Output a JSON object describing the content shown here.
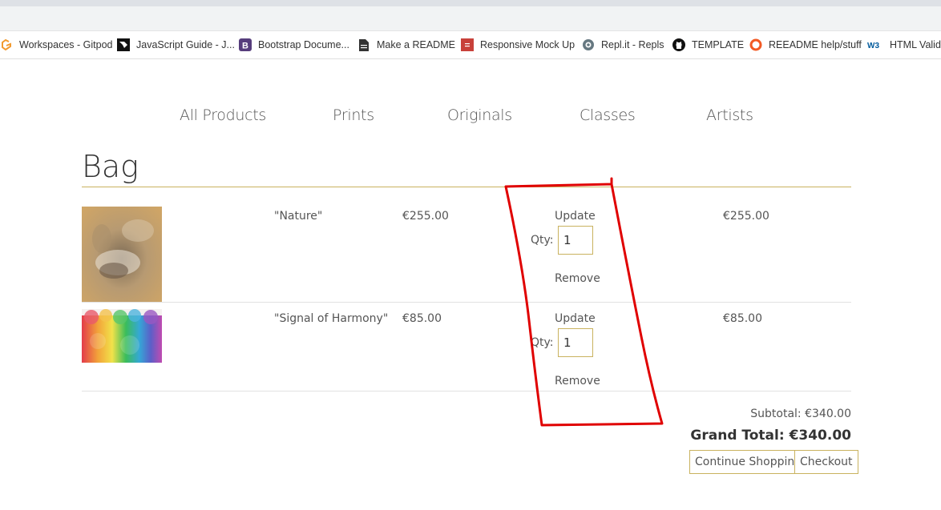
{
  "bookmarks": [
    {
      "label": "Workspaces - Gitpod",
      "icon": "gitpod-icon"
    },
    {
      "label": "JavaScript Guide - J...",
      "icon": "mdn-icon"
    },
    {
      "label": "Bootstrap Docume...",
      "icon": "bootstrap-icon"
    },
    {
      "label": "Make a README",
      "icon": "document-icon"
    },
    {
      "label": "Responsive Mock Up",
      "icon": "mockup-icon"
    },
    {
      "label": "Repl.it - Repls",
      "icon": "replit-icon"
    },
    {
      "label": "TEMPLATE",
      "icon": "github-icon"
    },
    {
      "label": "REEADME help/stuff",
      "icon": "circle-icon"
    },
    {
      "label": "HTML Validat",
      "icon": "w3c-icon"
    }
  ],
  "nav": [
    "All Products",
    "Prints",
    "Originals",
    "Classes",
    "Artists"
  ],
  "page_title": "Bag",
  "bag": {
    "items": [
      {
        "name": "\"Nature\"",
        "price": "€255.00",
        "update": "Update",
        "qty_label": "Qty:",
        "qty": "1",
        "remove": "Remove",
        "subtotal": "€255.00"
      },
      {
        "name": "\"Signal of Harmony\"",
        "price": "€85.00",
        "update": "Update",
        "qty_label": "Qty:",
        "qty": "1",
        "remove": "Remove",
        "subtotal": "€85.00"
      }
    ],
    "subtotal": "Subtotal: €340.00",
    "grand_total": "Grand Total: €340.00",
    "continue_label": "Continue Shopping",
    "checkout_label": "Checkout"
  },
  "colors": {
    "accent": "#c9b25f",
    "annotation": "#e00000"
  }
}
